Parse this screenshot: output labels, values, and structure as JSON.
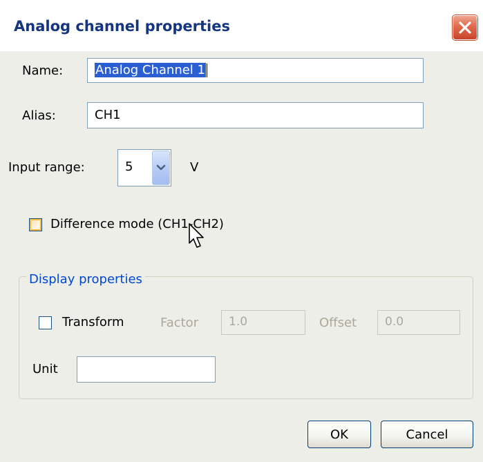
{
  "window": {
    "title": "Analog channel properties"
  },
  "name_field": {
    "label": "Name:",
    "value": "Analog Channel 1"
  },
  "alias_field": {
    "label": "Alias:",
    "value": "CH1"
  },
  "input_range": {
    "label": "Input range:",
    "value": "5",
    "unit": "V"
  },
  "difference_mode": {
    "label": "Difference mode (CH1-CH2)",
    "checked": false
  },
  "display_properties": {
    "title": "Display properties",
    "transform_label": "Transform",
    "transform_checked": false,
    "factor_label": "Factor",
    "factor_value": "1.0",
    "offset_label": "Offset",
    "offset_value": "0.0",
    "unit_label": "Unit",
    "unit_value": ""
  },
  "buttons": {
    "ok": "OK",
    "cancel": "Cancel"
  },
  "colors": {
    "title_text": "#15357e",
    "group_title": "#0046d5",
    "selection": "#2a5fd3",
    "close_button": "#e06a4d",
    "disabled_text": "#aca899"
  },
  "icons": {
    "close": "close-icon",
    "dropdown": "chevron-down-icon",
    "cursor": "mouse-pointer-icon"
  }
}
